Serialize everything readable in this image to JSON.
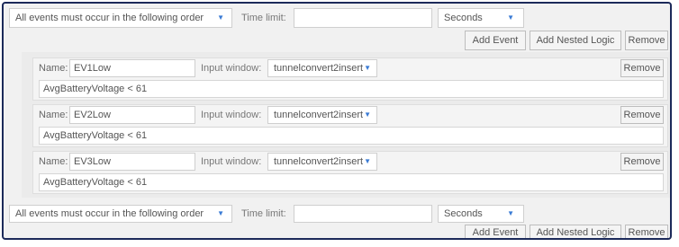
{
  "top_group": {
    "order_select": "All events must occur in the following order",
    "time_limit_label": "Time limit:",
    "time_limit_value": "",
    "unit_select": "Seconds",
    "add_event": "Add Event",
    "add_nested_logic": "Add Nested Logic",
    "remove": "Remove"
  },
  "events": [
    {
      "name_label": "Name:",
      "name": "EV1Low",
      "input_window_label": "Input window:",
      "input_window": "tunnelconvert2insert",
      "remove": "Remove",
      "condition": "AvgBatteryVoltage < 61"
    },
    {
      "name_label": "Name:",
      "name": "EV2Low",
      "input_window_label": "Input window:",
      "input_window": "tunnelconvert2insert",
      "remove": "Remove",
      "condition": "AvgBatteryVoltage < 61"
    },
    {
      "name_label": "Name:",
      "name": "EV3Low",
      "input_window_label": "Input window:",
      "input_window": "tunnelconvert2insert",
      "remove": "Remove",
      "condition": "AvgBatteryVoltage < 61"
    }
  ],
  "bottom_group": {
    "order_select": "All events must occur in the following order",
    "time_limit_label": "Time limit:",
    "time_limit_value": "",
    "unit_select": "Seconds",
    "add_event": "Add Event",
    "add_nested_logic": "Add Nested Logic",
    "remove": "Remove"
  },
  "icons": {
    "dropdown": "chevron-down-icon"
  },
  "colors": {
    "frame_border": "#1c2a5a",
    "caret": "#3a7bd5"
  }
}
